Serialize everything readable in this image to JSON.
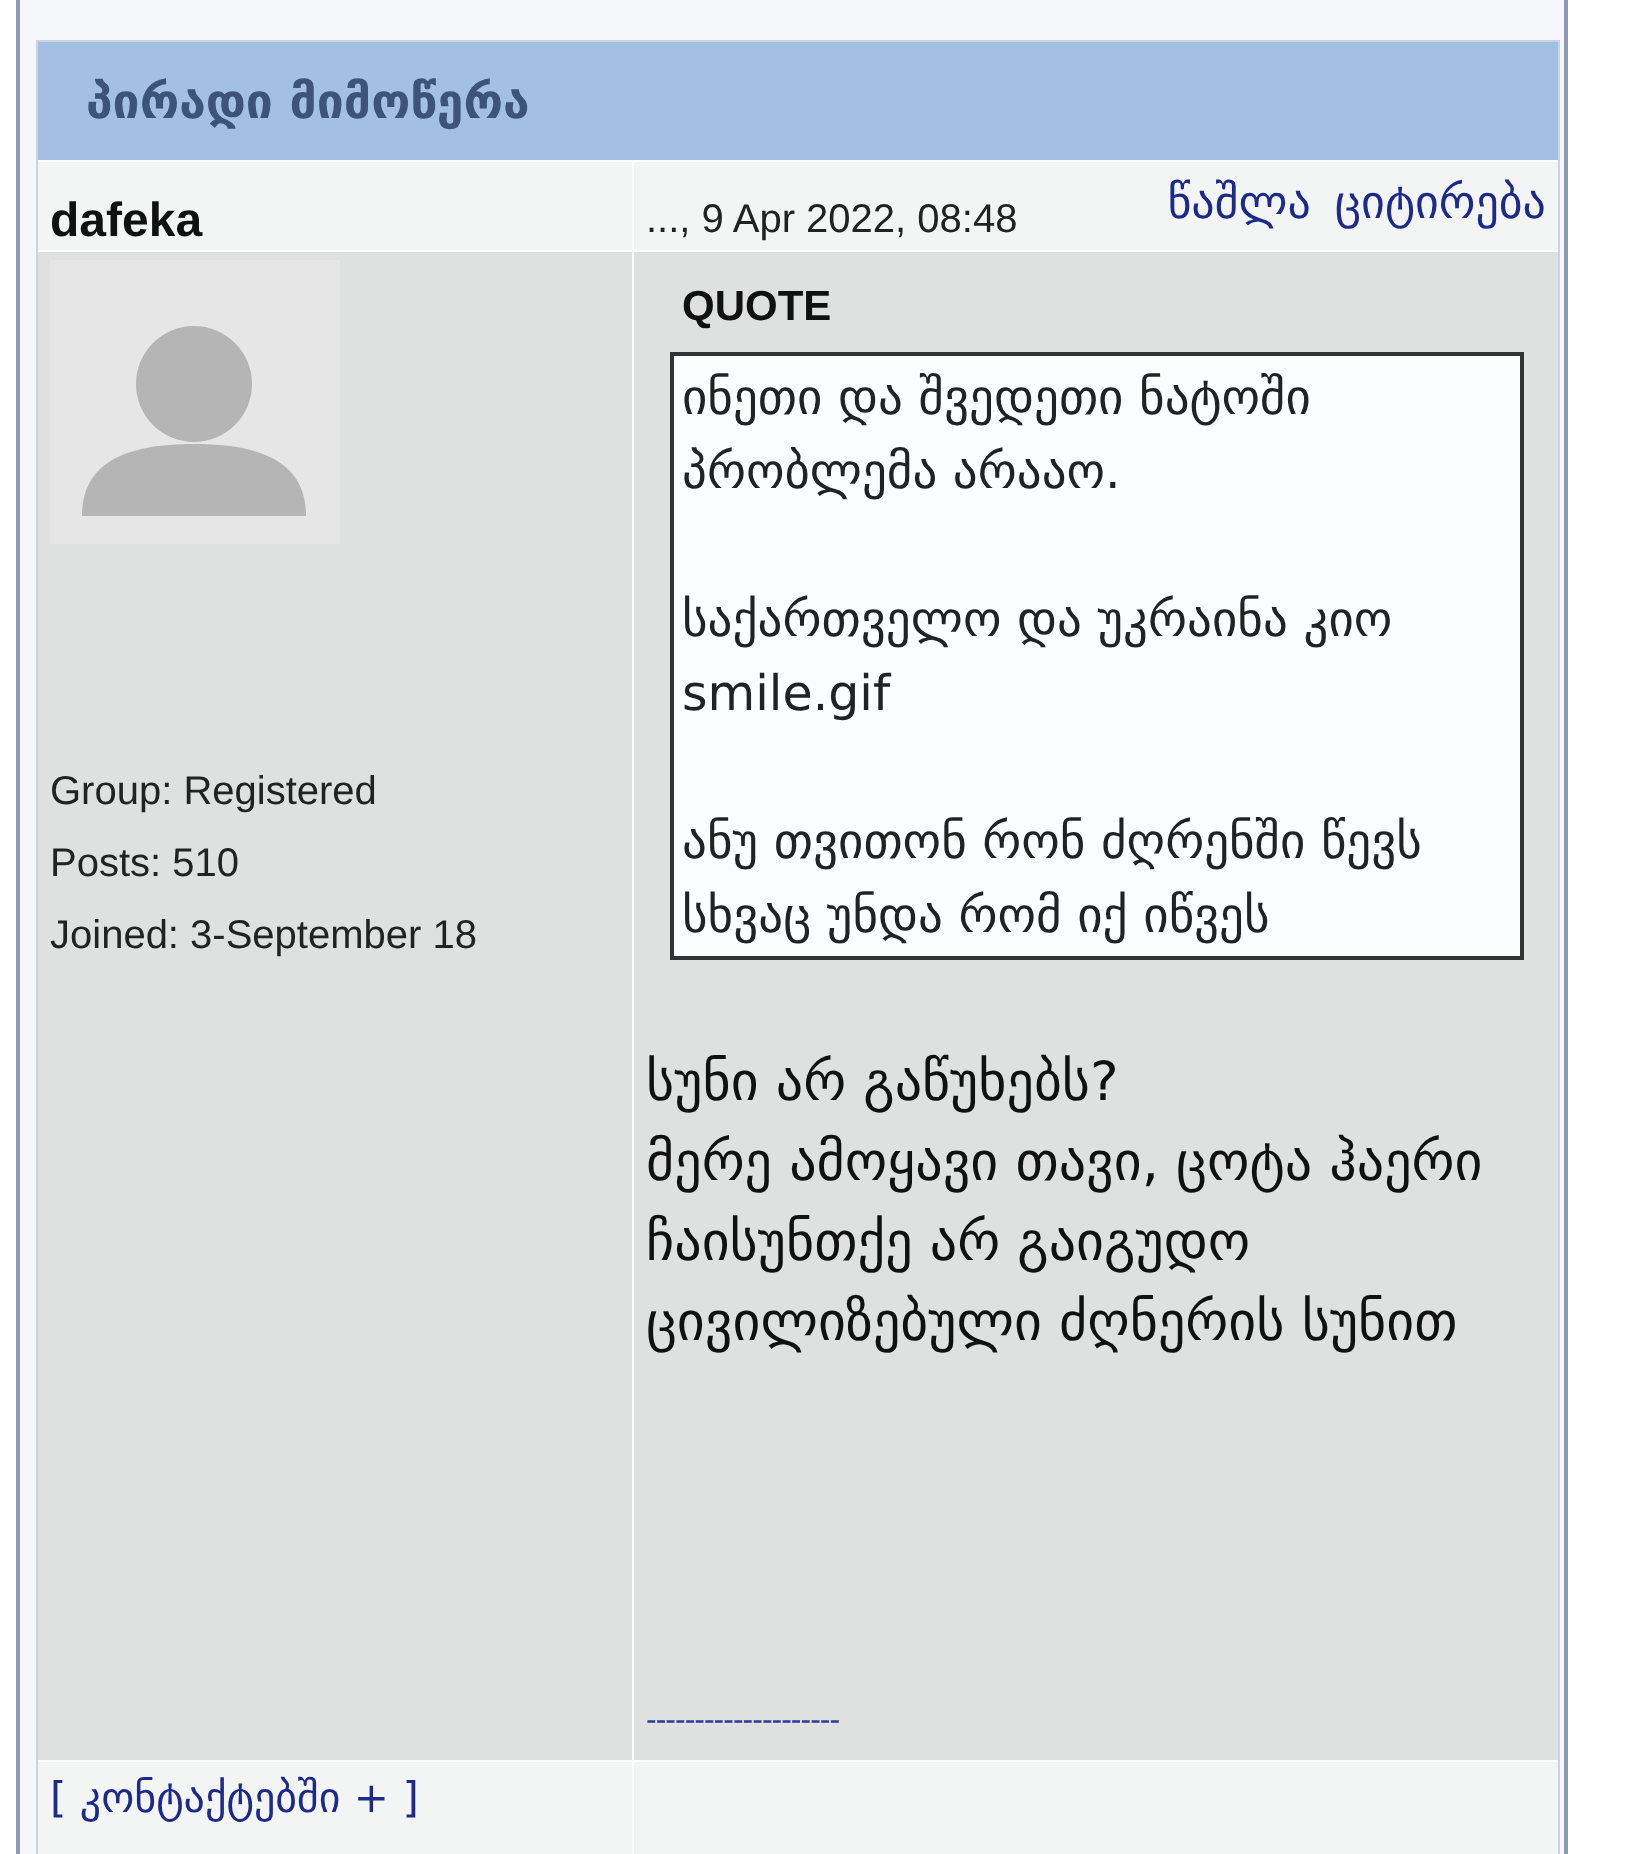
{
  "section": {
    "title": "პირადი მიმოწერა"
  },
  "post": {
    "author": "dafeka",
    "date": "..., 9 Apr 2022, 08:48",
    "actions": [
      {
        "label": "წაშლა"
      },
      {
        "label": "ციტირება"
      }
    ],
    "author_info": [
      "Group: Registered",
      "Posts: 510",
      "Joined: 3-September 18"
    ],
    "quote": {
      "label": "QUOTE",
      "paragraphs": [
        "ინეთი და შვედეთი ნატოში პრობლემა არააო.",
        "საქართველო და უკრაინა კიო smile.gif",
        "ანუ თვითონ რონ ძღრენში წევს სხვაც უნდა რომ იქ იწვეს"
      ]
    },
    "message": [
      "სუნი არ გაწუხებს?",
      "მერე ამოყავი თავი, ცოტა ჰაერი ჩაისუნთქე არ გაიგუდო ცივილიზებული ძღნერის სუნით"
    ],
    "signature": "--------------------",
    "contacts_link": "[ კონტაქტებში + ]"
  }
}
